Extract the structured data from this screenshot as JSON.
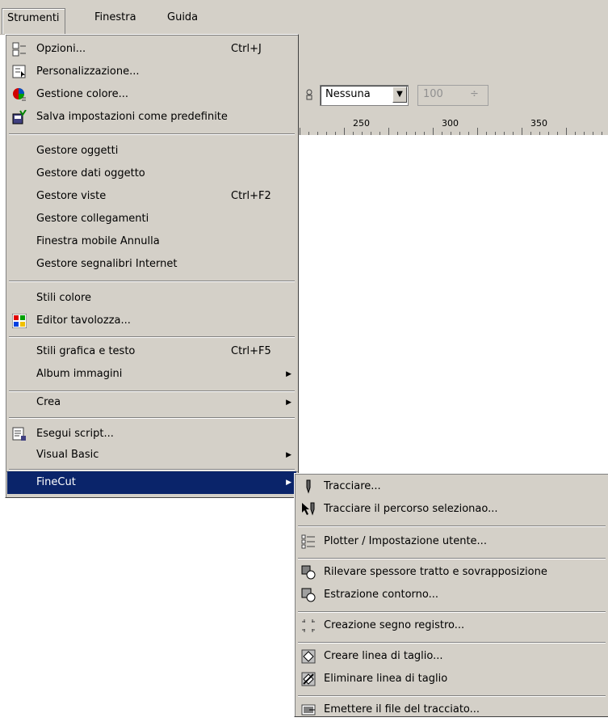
{
  "menubar": {
    "items": [
      {
        "label": "Strumenti"
      },
      {
        "label": "Finestra"
      },
      {
        "label": "Guida"
      }
    ]
  },
  "toolbar": {
    "combo_value": "Nessuna",
    "spin_value": "100"
  },
  "ruler": {
    "labels": [
      "250",
      "300",
      "350"
    ]
  },
  "strumenti_menu": {
    "items": [
      {
        "label": "Opzioni...",
        "shortcut": "Ctrl+J",
        "icon": "options-icon"
      },
      {
        "label": "Personalizzazione...",
        "icon": "customize-icon"
      },
      {
        "label": "Gestione colore...",
        "icon": "color-management-icon"
      },
      {
        "label": "Salva impostazioni come predefinite",
        "icon": "save-defaults-icon"
      },
      {
        "label": "Gestore oggetti"
      },
      {
        "label": "Gestore dati oggetto"
      },
      {
        "label": "Gestore viste",
        "shortcut": "Ctrl+F2"
      },
      {
        "label": "Gestore collegamenti"
      },
      {
        "label": "Finestra mobile Annulla"
      },
      {
        "label": "Gestore segnalibri Internet"
      },
      {
        "label": "Stili colore"
      },
      {
        "label": "Editor tavolozza...",
        "icon": "palette-editor-icon"
      },
      {
        "label": "Stili grafica e testo",
        "shortcut": "Ctrl+F5"
      },
      {
        "label": "Album immagini",
        "submenu": true
      },
      {
        "label": "Crea",
        "submenu": true
      },
      {
        "label": "Esegui script...",
        "icon": "run-script-icon"
      },
      {
        "label": "Visual Basic",
        "submenu": true
      },
      {
        "label": "FineCut",
        "submenu": true,
        "highlighted": true
      }
    ]
  },
  "finecut_menu": {
    "items": [
      {
        "label": "Tracciare...",
        "icon": "plot-pen-icon"
      },
      {
        "label": "Tracciare il percorso selezionao...",
        "icon": "plot-selected-path-icon"
      },
      {
        "label": "Plotter / Impostazione utente...",
        "icon": "plotter-settings-icon"
      },
      {
        "label": "Rilevare spessore tratto e sovrapposizione",
        "icon": "detect-stroke-icon"
      },
      {
        "label": "Estrazione contorno...",
        "icon": "extract-contour-icon"
      },
      {
        "label": "Creazione segno registro...",
        "icon": "register-mark-icon"
      },
      {
        "label": "Creare linea di taglio...",
        "icon": "create-cut-line-icon"
      },
      {
        "label": "Eliminare linea di taglio",
        "icon": "delete-cut-line-icon"
      },
      {
        "label": "Emettere il file del tracciato...",
        "icon": "output-plot-file-icon"
      }
    ]
  },
  "colors": {
    "menu_bg": "#d4d0c8",
    "highlight": "#0a246a"
  }
}
